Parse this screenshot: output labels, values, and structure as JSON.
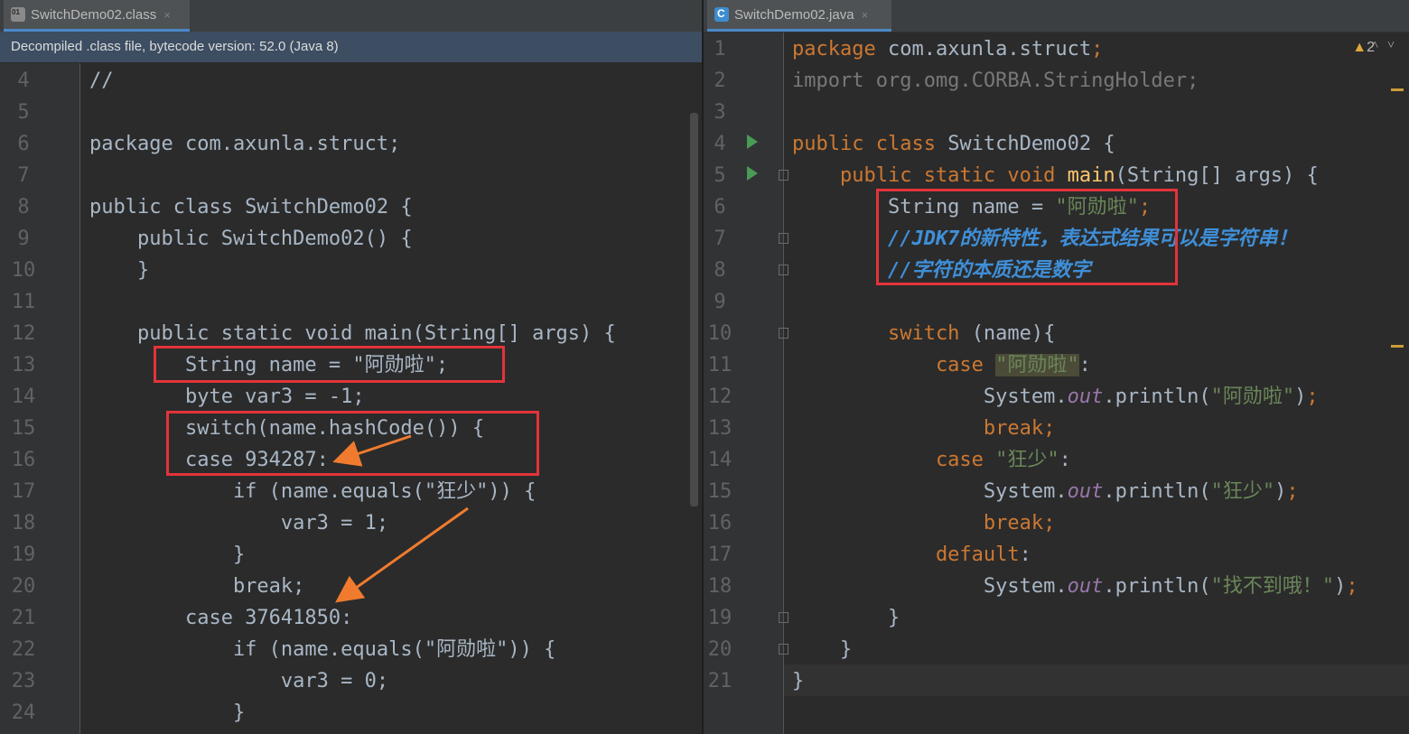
{
  "left": {
    "tab_title": "SwitchDemo02.class",
    "tab_close": "×",
    "banner": "Decompiled .class file, bytecode version: 52.0 (Java 8)",
    "lines": [
      {
        "n": "4",
        "tokens": [
          {
            "t": "//",
            "c": ""
          }
        ]
      },
      {
        "n": "5",
        "tokens": []
      },
      {
        "n": "6",
        "tokens": [
          {
            "t": "package com.axunla.struct;",
            "c": ""
          }
        ]
      },
      {
        "n": "7",
        "tokens": []
      },
      {
        "n": "8",
        "tokens": [
          {
            "t": "public class SwitchDemo02 {",
            "c": ""
          }
        ]
      },
      {
        "n": "9",
        "tokens": [
          {
            "t": "    public SwitchDemo02() {",
            "c": ""
          }
        ]
      },
      {
        "n": "10",
        "tokens": [
          {
            "t": "    }",
            "c": ""
          }
        ]
      },
      {
        "n": "11",
        "tokens": []
      },
      {
        "n": "12",
        "tokens": [
          {
            "t": "    public static void main(String[] args) {",
            "c": ""
          }
        ]
      },
      {
        "n": "13",
        "tokens": [
          {
            "t": "        String name = \"阿勋啦\";",
            "c": ""
          }
        ]
      },
      {
        "n": "14",
        "tokens": [
          {
            "t": "        byte var3 = -1;",
            "c": ""
          }
        ]
      },
      {
        "n": "15",
        "tokens": [
          {
            "t": "        switch(name.hashCode()) {",
            "c": ""
          }
        ]
      },
      {
        "n": "16",
        "tokens": [
          {
            "t": "        case 934287:",
            "c": ""
          }
        ]
      },
      {
        "n": "17",
        "tokens": [
          {
            "t": "            if (name.equals(\"狂少\")) {",
            "c": ""
          }
        ]
      },
      {
        "n": "18",
        "tokens": [
          {
            "t": "                var3 = 1;",
            "c": ""
          }
        ]
      },
      {
        "n": "19",
        "tokens": [
          {
            "t": "            }",
            "c": ""
          }
        ]
      },
      {
        "n": "20",
        "tokens": [
          {
            "t": "            break;",
            "c": ""
          }
        ]
      },
      {
        "n": "21",
        "tokens": [
          {
            "t": "        case 37641850:",
            "c": ""
          }
        ]
      },
      {
        "n": "22",
        "tokens": [
          {
            "t": "            if (name.equals(\"阿勋啦\")) {",
            "c": ""
          }
        ]
      },
      {
        "n": "23",
        "tokens": [
          {
            "t": "                var3 = 0;",
            "c": ""
          }
        ]
      },
      {
        "n": "24",
        "tokens": [
          {
            "t": "            }",
            "c": ""
          }
        ]
      }
    ]
  },
  "right": {
    "tab_title": "SwitchDemo02.java",
    "tab_close": "×",
    "warning_count": "2",
    "lines": [
      {
        "n": "1",
        "tokens": [
          {
            "t": "package ",
            "c": "kw"
          },
          {
            "t": "com.axunla.struct",
            "c": ""
          },
          {
            "t": ";",
            "c": "kw"
          }
        ]
      },
      {
        "n": "2",
        "tokens": [
          {
            "t": "import org.omg.CORBA.StringHolder;",
            "c": "dim"
          }
        ]
      },
      {
        "n": "3",
        "tokens": []
      },
      {
        "n": "4",
        "tokens": [
          {
            "t": "public class ",
            "c": "kw"
          },
          {
            "t": "SwitchDemo02 {",
            "c": ""
          }
        ]
      },
      {
        "n": "5",
        "tokens": [
          {
            "t": "    public static void ",
            "c": "kw"
          },
          {
            "t": "main",
            "c": "fn"
          },
          {
            "t": "(String[] args) {",
            "c": ""
          }
        ]
      },
      {
        "n": "6",
        "tokens": [
          {
            "t": "        String name = ",
            "c": ""
          },
          {
            "t": "\"阿勋啦\"",
            "c": "str"
          },
          {
            "t": ";",
            "c": "kw"
          }
        ]
      },
      {
        "n": "7",
        "tokens": [
          {
            "t": "        //JDK7的新特性，表达式结果可以是字符串！",
            "c": "blue-cm"
          }
        ]
      },
      {
        "n": "8",
        "tokens": [
          {
            "t": "        //字符的本质还是数字",
            "c": "blue-cm"
          }
        ]
      },
      {
        "n": "9",
        "tokens": []
      },
      {
        "n": "10",
        "tokens": [
          {
            "t": "        switch ",
            "c": "kw"
          },
          {
            "t": "(name){",
            "c": ""
          }
        ]
      },
      {
        "n": "11",
        "tokens": [
          {
            "t": "            case ",
            "c": "kw"
          },
          {
            "t": "\"阿勋啦\"",
            "c": "str hl"
          },
          {
            "t": ":",
            "c": ""
          }
        ]
      },
      {
        "n": "12",
        "tokens": [
          {
            "t": "                System.",
            "c": ""
          },
          {
            "t": "out",
            "c": "fld"
          },
          {
            "t": ".println(",
            "c": ""
          },
          {
            "t": "\"阿勋啦\"",
            "c": "str"
          },
          {
            "t": ")",
            "c": ""
          },
          {
            "t": ";",
            "c": "kw"
          }
        ]
      },
      {
        "n": "13",
        "tokens": [
          {
            "t": "                break;",
            "c": "kw"
          }
        ]
      },
      {
        "n": "14",
        "tokens": [
          {
            "t": "            case ",
            "c": "kw"
          },
          {
            "t": "\"狂少\"",
            "c": "str"
          },
          {
            "t": ":",
            "c": ""
          }
        ]
      },
      {
        "n": "15",
        "tokens": [
          {
            "t": "                System.",
            "c": ""
          },
          {
            "t": "out",
            "c": "fld"
          },
          {
            "t": ".println(",
            "c": ""
          },
          {
            "t": "\"狂少\"",
            "c": "str"
          },
          {
            "t": ")",
            "c": ""
          },
          {
            "t": ";",
            "c": "kw"
          }
        ]
      },
      {
        "n": "16",
        "tokens": [
          {
            "t": "                break;",
            "c": "kw"
          }
        ]
      },
      {
        "n": "17",
        "tokens": [
          {
            "t": "            default",
            "c": "kw"
          },
          {
            "t": ":",
            "c": ""
          }
        ]
      },
      {
        "n": "18",
        "tokens": [
          {
            "t": "                System.",
            "c": ""
          },
          {
            "t": "out",
            "c": "fld"
          },
          {
            "t": ".println(",
            "c": ""
          },
          {
            "t": "\"找不到哦！\"",
            "c": "str"
          },
          {
            "t": ")",
            "c": ""
          },
          {
            "t": ";",
            "c": "kw"
          }
        ]
      },
      {
        "n": "19",
        "tokens": [
          {
            "t": "        }",
            "c": ""
          }
        ]
      },
      {
        "n": "20",
        "tokens": [
          {
            "t": "    }",
            "c": ""
          }
        ]
      },
      {
        "n": "21",
        "tokens": [
          {
            "t": "}",
            "c": ""
          }
        ]
      }
    ]
  },
  "colors": {
    "accent_tab": "#4a88c7",
    "annotation_red": "#e3333a",
    "arrow_orange": "#f07b2e",
    "run_green": "#499c54"
  }
}
